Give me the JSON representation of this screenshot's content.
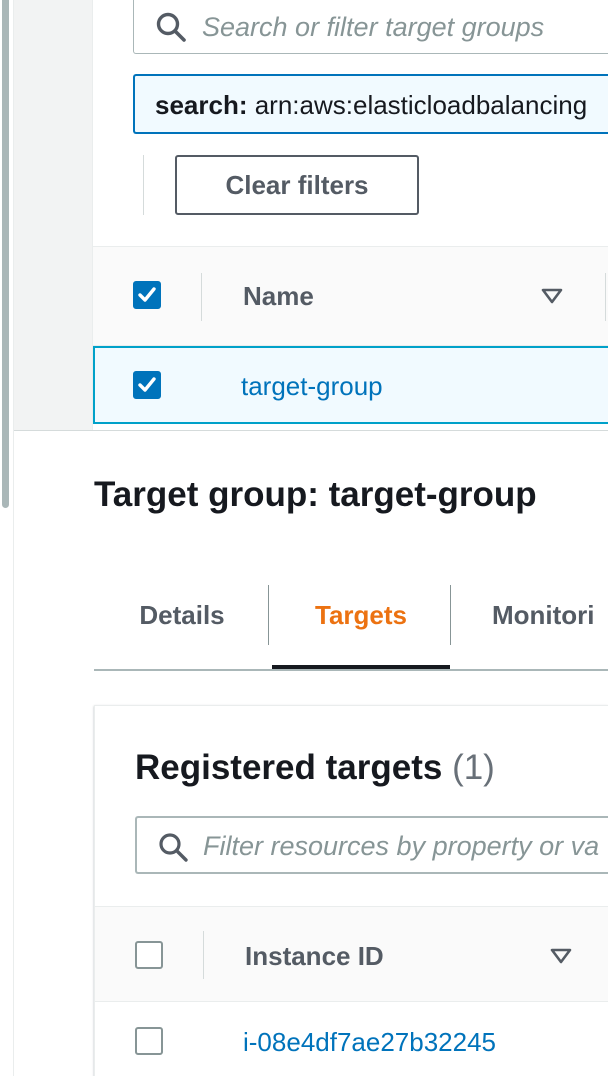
{
  "target_groups": {
    "search": {
      "placeholder": "Search or filter target groups"
    },
    "filter_token": {
      "key": "search:",
      "value": " arn:aws:elasticloadbalancing"
    },
    "clear_filters_label": "Clear filters",
    "table": {
      "columns": [
        {
          "label": "Name"
        }
      ],
      "header_checkbox_checked": true,
      "rows": [
        {
          "name": "target-group",
          "selected": true
        }
      ]
    }
  },
  "detail": {
    "title": "Target group: target-group",
    "tabs": [
      {
        "label": "Details",
        "active": false
      },
      {
        "label": "Targets",
        "active": true
      },
      {
        "label": "Monitori",
        "active": false
      }
    ],
    "registered_targets": {
      "title": "Registered targets",
      "count": "(1)",
      "filter_placeholder": "Filter resources by property or va",
      "columns": [
        {
          "label": "Instance ID"
        }
      ],
      "rows": [
        {
          "instance_id": "i-08e4df7ae27b32245",
          "selected": false
        }
      ]
    }
  },
  "colors": {
    "link": "#0073bb",
    "active_tab": "#ec7211",
    "selected_row_bg": "#f1faff",
    "selected_row_border": "#00a1c9",
    "checkbox_checked": "#0073bb"
  },
  "icons": [
    "search-icon",
    "checkmark-icon",
    "sort-down-icon"
  ]
}
